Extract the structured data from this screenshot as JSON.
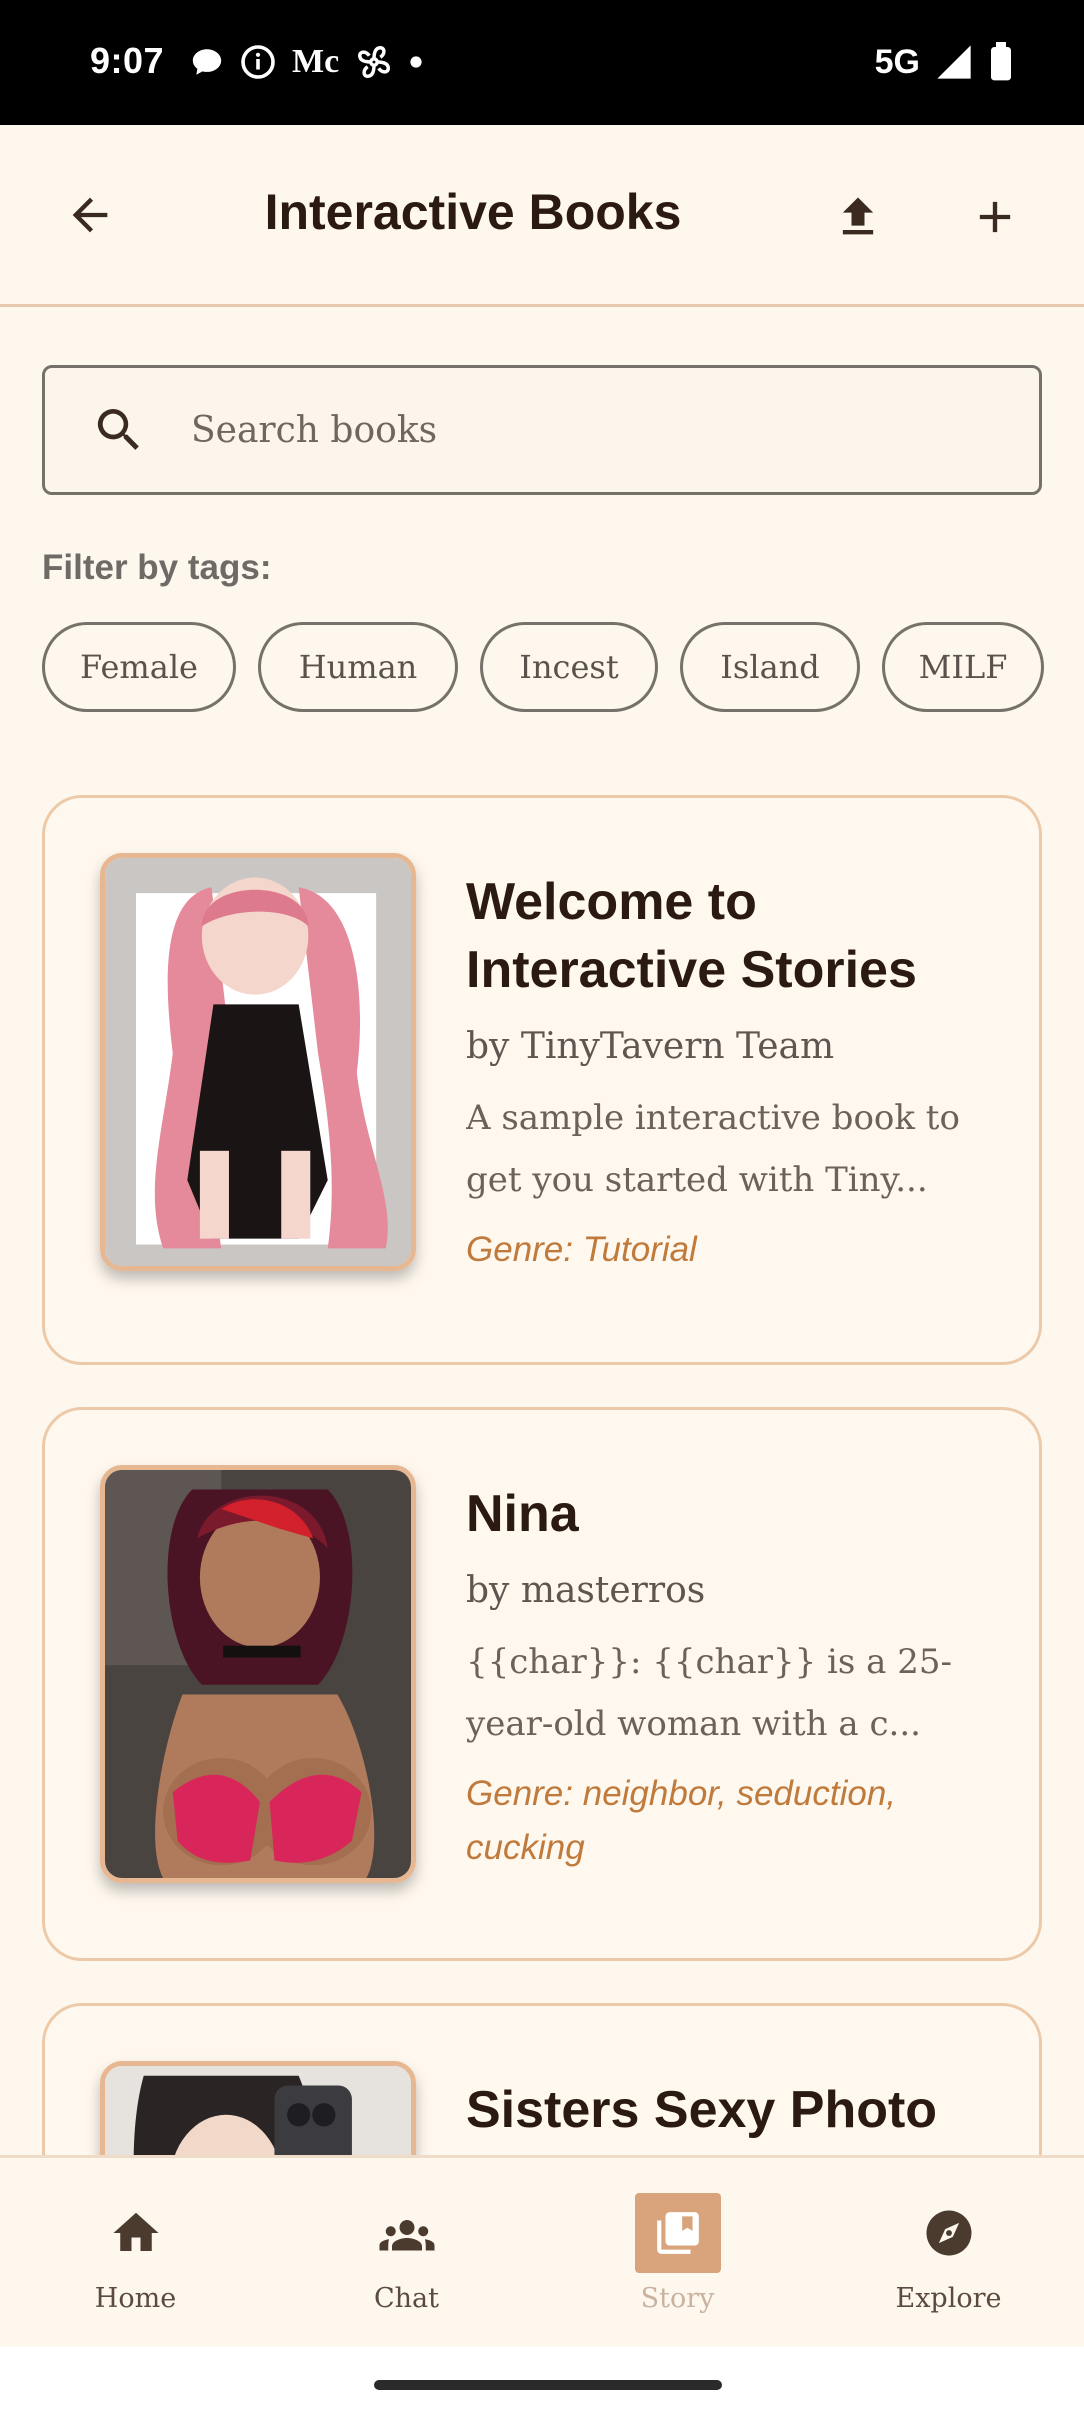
{
  "status": {
    "time": "9:07",
    "network": "5G",
    "icons_left": [
      "chat-bubble-icon",
      "info-icon",
      "m-icon",
      "fan-icon",
      "dot-icon"
    ],
    "icons_right": [
      "signal-icon",
      "battery-icon"
    ]
  },
  "appbar": {
    "title": "Interactive Books",
    "back_icon": "arrow-back-icon",
    "upload_icon": "upload-icon",
    "add_icon": "add-icon"
  },
  "search": {
    "placeholder": "Search books",
    "value": ""
  },
  "filter": {
    "label": "Filter by tags:",
    "tags": [
      "Female",
      "Human",
      "Incest",
      "Island",
      "MILF"
    ]
  },
  "books": [
    {
      "title": "Welcome to Interactive Stories",
      "author": "by TinyTavern Team",
      "description": "A sample interactive book to get you started with Tiny...",
      "genre": "Genre: Tutorial"
    },
    {
      "title": "Nina",
      "author": "by masterros",
      "description": "{{char}}: {{char}} is a 25-year-old woman with a c...",
      "genre": "Genre: neighbor, seduction, cucking"
    },
    {
      "title": "Sisters Sexy Photo",
      "author": "",
      "description": "",
      "genre": ""
    }
  ],
  "nav": {
    "items": [
      {
        "label": "Home",
        "icon": "home-icon"
      },
      {
        "label": "Chat",
        "icon": "people-icon"
      },
      {
        "label": "Story",
        "icon": "book-icon",
        "active": true
      },
      {
        "label": "Explore",
        "icon": "compass-icon"
      }
    ]
  },
  "colors": {
    "background": "#fdf7ee",
    "accent": "#d9a37b",
    "genre_text": "#c07a3c",
    "card_border": "#ecc9a8"
  }
}
